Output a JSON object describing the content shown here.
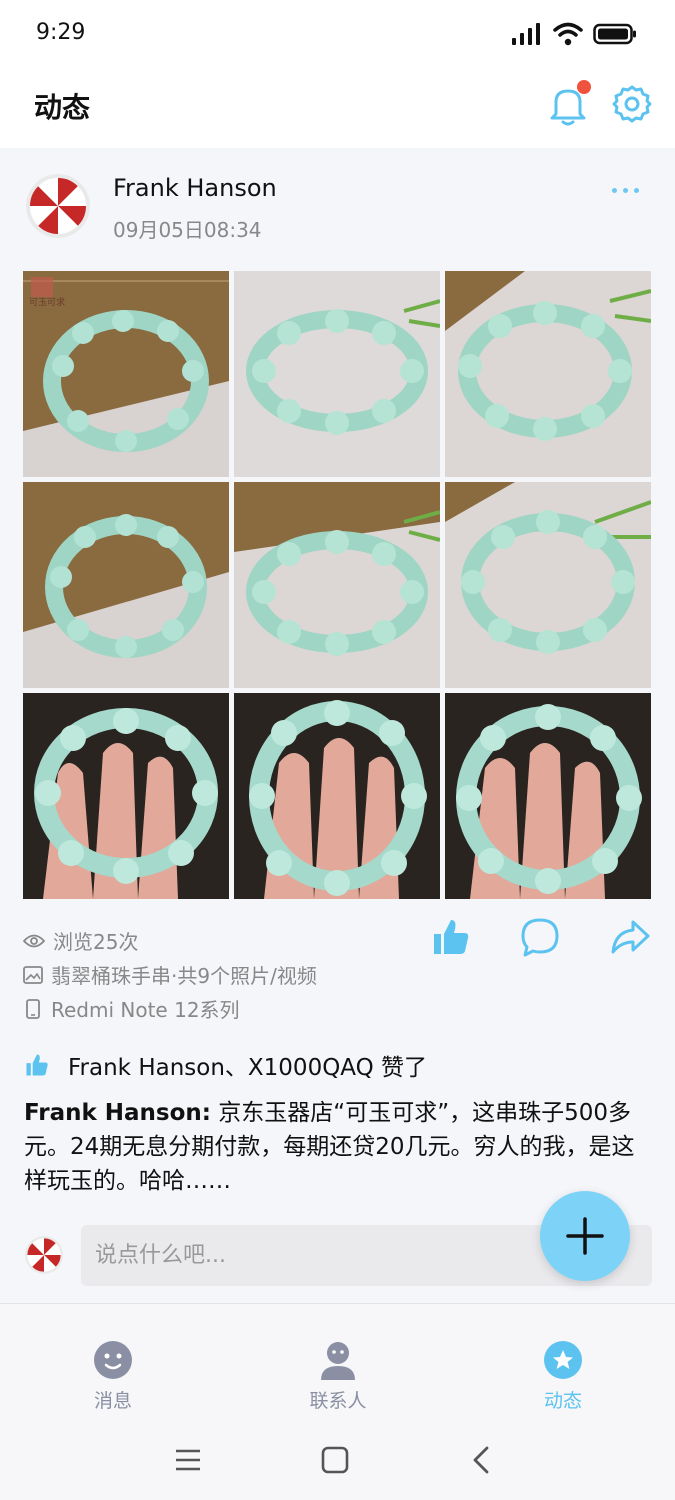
{
  "status": {
    "time": "9:29"
  },
  "header": {
    "title": "动态",
    "bell_icon": "bell-icon",
    "settings_icon": "gear-icon"
  },
  "post": {
    "author": "Frank Hanson",
    "time": "09月05日08:34",
    "views": "浏览25次",
    "album": "翡翠桶珠手串·共9个照片/视频",
    "device": "Redmi Note 12系列",
    "likes": "Frank Hanson、X1000QAQ 赞了",
    "content_author": "Frank Hanson:",
    "content_text": " 京东玉器店“可玉可求”，这串珠子500多元。24期无息分期付款，每期还贷20几元。穷人的我，是这样玩玉的。哈哈……",
    "watermark": "可玉可求"
  },
  "comment": {
    "placeholder": "说点什么吧..."
  },
  "tabs": [
    {
      "label": "消息",
      "icon": "message-face-icon",
      "active": false
    },
    {
      "label": "联系人",
      "icon": "contacts-icon",
      "active": false
    },
    {
      "label": "动态",
      "icon": "moments-star-icon",
      "active": true
    }
  ],
  "colors": {
    "accent": "#5cc3f0",
    "inactive": "#8a8fa3",
    "badge": "#f0533d"
  }
}
